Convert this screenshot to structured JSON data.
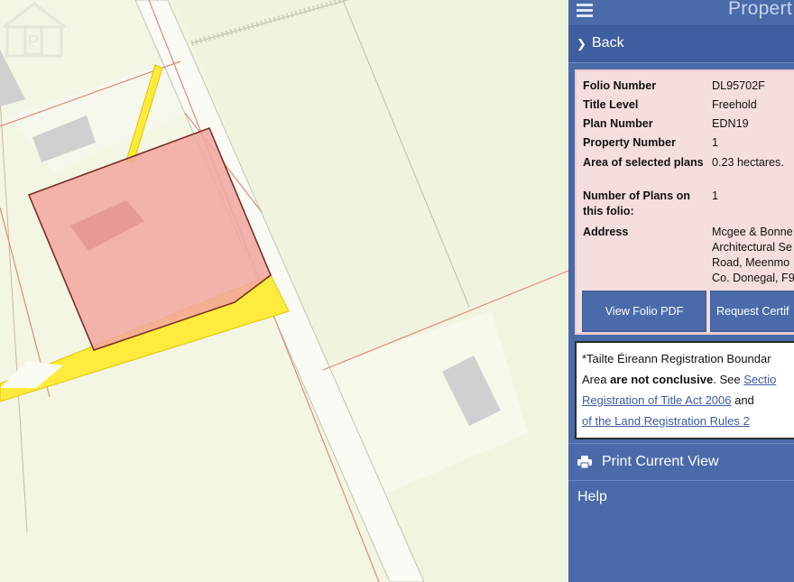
{
  "topbar": {
    "title": "Propert",
    "menu_icon": "hamburger-icon"
  },
  "back": {
    "label": "Back",
    "icon": "chevron-right-icon"
  },
  "property": {
    "rows": [
      {
        "key": "Folio Number",
        "value": "DL95702F"
      },
      {
        "key": "Title Level",
        "value": "Freehold"
      },
      {
        "key": "Plan Number",
        "value": "EDN19"
      },
      {
        "key": "Property Number",
        "value": "1"
      },
      {
        "key": "Area of selected plans",
        "value": "0.23 hectares."
      },
      {
        "key": "Number of Plans on this folio:",
        "value": "1"
      },
      {
        "key": "Address",
        "value": "Mcgee & Bonne\nArchitectural Se\nRoad, Meenmo\nCo. Donegal, F9"
      }
    ],
    "view_pdf_label": "View Folio PDF",
    "request_cert_label": "Request Certif"
  },
  "disclaimer": {
    "line1": "*Tailte Éireann Registration Boundar",
    "line2_pre": "Area ",
    "line2_bold": "are not conclusive",
    "line2_post": ". See ",
    "line2_link": "Sectio",
    "line3_link": "Registration of Title Act 2006",
    "line3_post": " and",
    "line4_link": "of the Land Registration Rules 2"
  },
  "print": {
    "label": "Print Current View",
    "icon": "printer-icon"
  },
  "help": {
    "label": "Help"
  },
  "colors": {
    "panel_bg": "#4a6aaa",
    "card_bg": "#f7dede",
    "parcel_fill": "#f2a6a0",
    "road_yellow": "#ffeb3b",
    "map_bg": "#f3f6e2"
  },
  "map": {
    "watermark_icon": "property-logo-watermark-icon"
  }
}
